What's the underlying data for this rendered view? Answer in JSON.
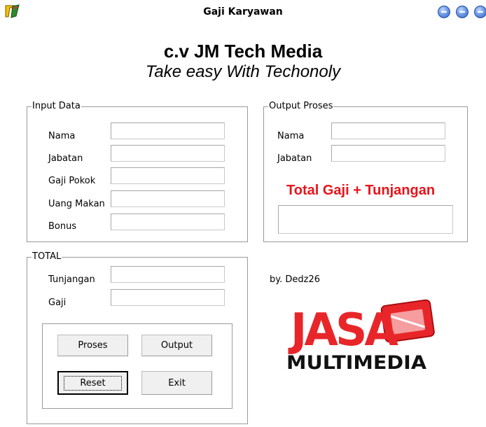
{
  "window": {
    "title": "Gaji Karyawan"
  },
  "header": {
    "company": "c.v JM Tech Media",
    "tagline": "Take easy With Techonoly"
  },
  "input_data": {
    "legend": "Input Data",
    "nama_label": "Nama",
    "jabatan_label": "Jabatan",
    "gaji_pokok_label": "Gaji Pokok",
    "uang_makan_label": "Uang Makan",
    "bonus_label": "Bonus",
    "nama_value": "",
    "jabatan_value": "",
    "gaji_pokok_value": "",
    "uang_makan_value": "",
    "bonus_value": ""
  },
  "output_proses": {
    "legend": "Output Proses",
    "nama_label": "Nama",
    "jabatan_label": "Jabatan",
    "total_title": "Total Gaji + Tunjangan",
    "nama_value": "",
    "jabatan_value": "",
    "total_value": ""
  },
  "total": {
    "legend": "TOTAL",
    "tunjangan_label": "Tunjangan",
    "gaji_label": "Gaji",
    "tunjangan_value": "",
    "gaji_value": ""
  },
  "buttons": {
    "proses": "Proses",
    "output": "Output",
    "reset": "Reset",
    "exit": "Exit"
  },
  "credit": {
    "byline": "by. Dedz26"
  },
  "logo": {
    "top_text": "JASA",
    "bottom_text": "MULTIMEDIA",
    "color": "#e8262a"
  }
}
